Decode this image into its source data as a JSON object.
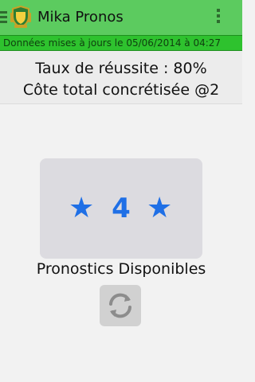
{
  "app": {
    "title": "Mika Pronos"
  },
  "update_bar": {
    "text": "Données mises à jours le 05/06/2014 à 04:27"
  },
  "stats": {
    "success_rate": "Taux de réussite : 80%",
    "total_odds": "Côte total concrétisée @2"
  },
  "card": {
    "count": "4"
  },
  "available_label": "Pronostics Disponibles",
  "icons": {
    "menu": "hamburger-icon",
    "logo": "crest-logo",
    "overflow": "vertical-dots-icon",
    "star": "star-icon",
    "refresh": "refresh-icon"
  },
  "colors": {
    "appbar": "#5ccb5f",
    "update_bar": "#2ec22e",
    "accent_blue": "#1f6fe6",
    "card_bg": "#dcdbe0"
  }
}
